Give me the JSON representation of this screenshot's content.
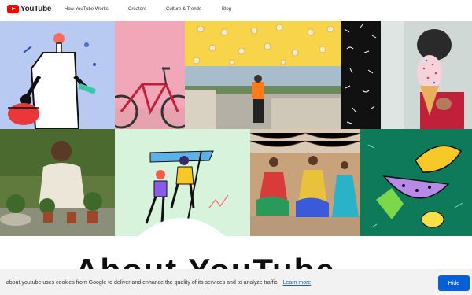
{
  "header": {
    "logo_text": "YouTube",
    "nav": [
      "How YouTube Works",
      "Creators",
      "Culture & Trends",
      "Blog"
    ]
  },
  "hero": {
    "heading_partial": "About YouTube",
    "tiles": [
      {
        "name": "scientist-illustration",
        "bg": "#b8c9f2"
      },
      {
        "name": "pink-bicycle-photo",
        "bg": "#f2a7b8"
      },
      {
        "name": "popcorn-on-yellow-photo",
        "bg": "#f7d44a"
      },
      {
        "name": "black-pattern-tile",
        "bg": "#111111"
      },
      {
        "name": "ice-cream-photo",
        "bg": "#cfd8d4"
      },
      {
        "name": "motorcycle-rider-photo",
        "bg": "#7a8fa0"
      },
      {
        "name": "gardener-photo",
        "bg": "#5f7a3c"
      },
      {
        "name": "climbers-illustration",
        "bg": "#d8f3dc"
      },
      {
        "name": "dancers-photo",
        "bg": "#c08a5a"
      },
      {
        "name": "fruit-illustration",
        "bg": "#0f7a5a"
      }
    ]
  },
  "cookie_banner": {
    "text": "about.youtube uses cookies from Google to deliver and enhance the quality of its services and to analyze traffic.",
    "link": "Learn more",
    "button": "Hide"
  },
  "colors": {
    "brand_red": "#ff0000",
    "accent_blue": "#065fd4"
  }
}
